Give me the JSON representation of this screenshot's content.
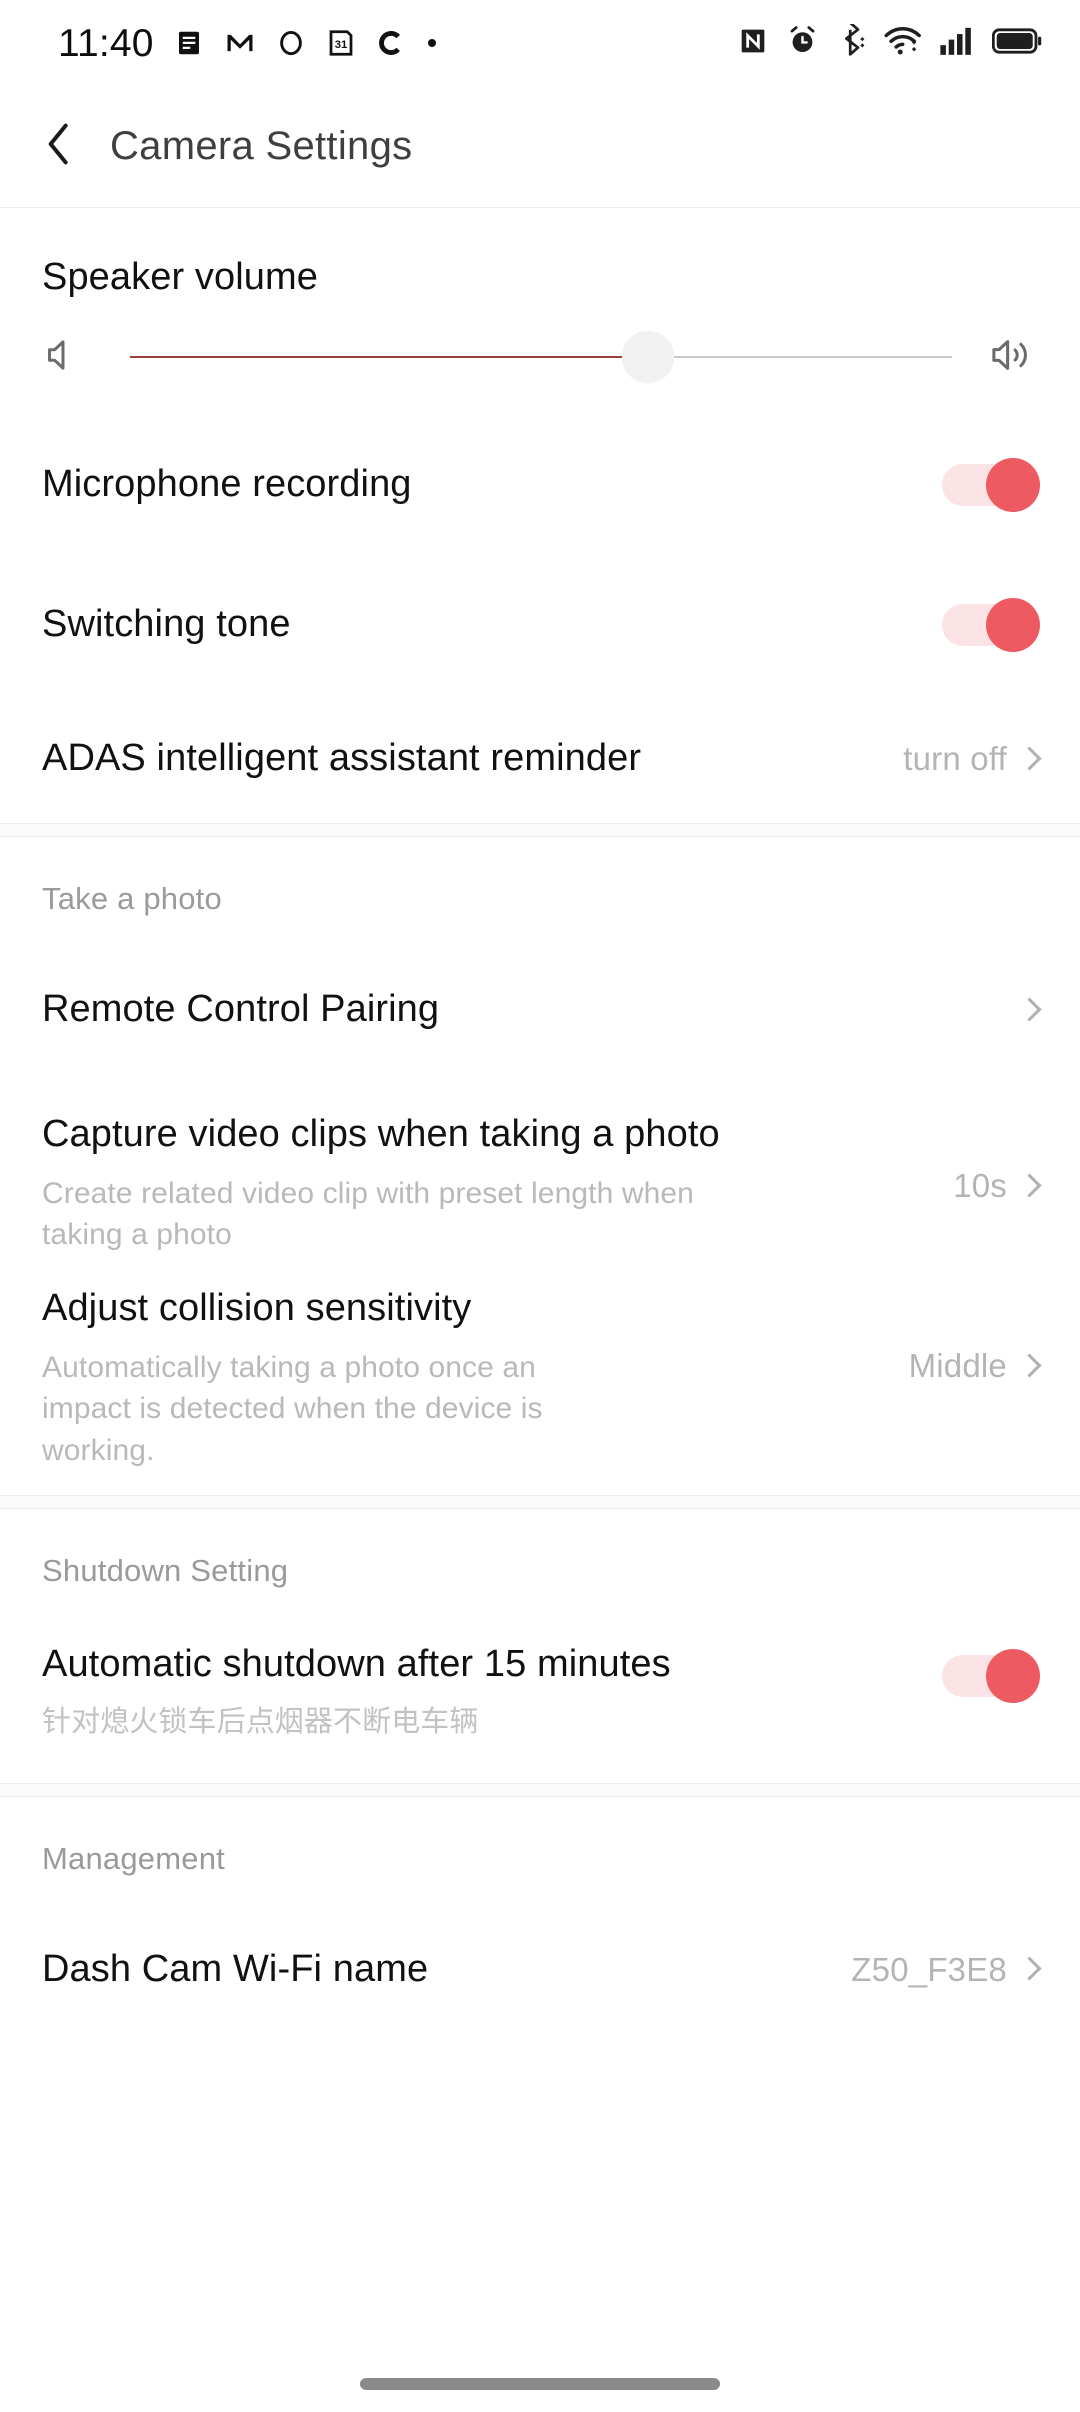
{
  "status_bar": {
    "time": "11:40",
    "left_icons": [
      "notes-icon",
      "gmail-icon",
      "circle-app-icon",
      "calendar-31-icon",
      "c-app-icon",
      "dot-icon"
    ],
    "right_icons": [
      "nfc-icon",
      "alarm-icon",
      "bluetooth-icon",
      "wifi-icon",
      "cellular-signal-icon",
      "battery-icon"
    ]
  },
  "header": {
    "back_icon": "chevron-left-icon",
    "title": "Camera Settings"
  },
  "volume": {
    "label": "Speaker volume",
    "min_icon": "volume-mute-icon",
    "max_icon": "volume-high-icon",
    "percent": 63
  },
  "toggles": {
    "microphone": {
      "label": "Microphone recording",
      "on": true
    },
    "switching_tone": {
      "label": "Switching tone",
      "on": true
    },
    "auto_shutdown": {
      "label": "Automatic shutdown after 15 minutes",
      "subtitle": "针对熄火锁车后点烟器不断电车辆",
      "on": true
    }
  },
  "adas": {
    "label": "ADAS intelligent assistant reminder",
    "value": "turn off"
  },
  "take_a_photo": {
    "caption": "Take a photo",
    "rows": [
      {
        "title": "Remote Control Pairing",
        "subtitle": "",
        "value": ""
      },
      {
        "title": "Capture video clips when taking a photo",
        "subtitle": "Create related video clip with preset length when taking a photo",
        "value": "10s"
      },
      {
        "title": "Adjust collision sensitivity",
        "subtitle": "Automatically taking a photo once an impact is detected when the device is working.",
        "value": "Middle"
      }
    ]
  },
  "shutdown_setting": {
    "caption": "Shutdown Setting"
  },
  "management": {
    "caption": "Management",
    "rows": [
      {
        "title": "Dash Cam Wi-Fi name",
        "value": "Z50_F3E8"
      }
    ]
  },
  "colors": {
    "accent": "#ee5a61",
    "accent_track": "#fbe2e5",
    "slider_fill": "#9d3f3d",
    "text_primary": "#111111",
    "text_secondary": "#b4b4b4"
  }
}
